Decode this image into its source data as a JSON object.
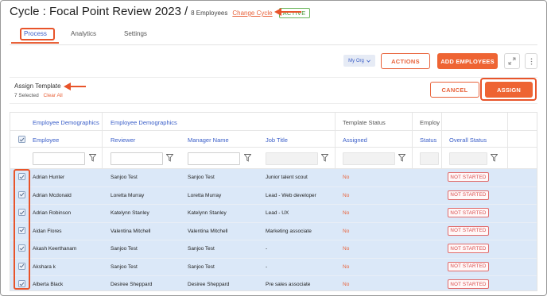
{
  "header": {
    "title": "Cycle : Focal Point Review 2023",
    "separator": "/",
    "employee_count": "8 Employees",
    "change_cycle": "Change Cycle",
    "status": "ACTIVE"
  },
  "tabs": [
    {
      "label": "Process"
    },
    {
      "label": "Analytics"
    },
    {
      "label": "Settings"
    }
  ],
  "toolbar": {
    "org_select": "My Org",
    "actions_label": "ACTIONS",
    "add_employees_label": "ADD EMPLOYEES"
  },
  "template_bar": {
    "title": "Assign Template",
    "selected": "7 Selected",
    "clear_all": "Clear All",
    "cancel_label": "CANCEL",
    "assign_label": "ASSIGN"
  },
  "table": {
    "group_headers": [
      "Employee Demographics",
      "Employee Demographics",
      "Template Status",
      "Employ"
    ],
    "columns": [
      "Employee",
      "Reviewer",
      "Manager Name",
      "Job Title",
      "Assigned",
      "Status",
      "Overall Status"
    ],
    "rows": [
      {
        "employee": "Adrian Hunter",
        "reviewer": "Sanjoo Test",
        "manager": "Sanjoo Test",
        "job": "Junior talent scout",
        "assigned": "No",
        "status": "",
        "overall": "NOT STARTED"
      },
      {
        "employee": "Adrian Mcdonald",
        "reviewer": "Loretta Murray",
        "manager": "Loretta Murray",
        "job": "Lead - Web developer",
        "assigned": "No",
        "status": "",
        "overall": "NOT STARTED"
      },
      {
        "employee": "Adrian Robinson",
        "reviewer": "Katelynn Stanley",
        "manager": "Katelynn Stanley",
        "job": "Lead - UX",
        "assigned": "No",
        "status": "",
        "overall": "NOT STARTED"
      },
      {
        "employee": "Aidan Flores",
        "reviewer": "Valentina Mitchell",
        "manager": "Valentina Mitchell",
        "job": "Marketing associate",
        "assigned": "No",
        "status": "",
        "overall": "NOT STARTED"
      },
      {
        "employee": "Akash Keerthanam",
        "reviewer": "Sanjoo Test",
        "manager": "Sanjoo Test",
        "job": "-",
        "assigned": "No",
        "status": "",
        "overall": "NOT STARTED"
      },
      {
        "employee": "Akshara k",
        "reviewer": "Sanjoo Test",
        "manager": "Sanjoo Test",
        "job": "-",
        "assigned": "No",
        "status": "",
        "overall": "NOT STARTED"
      },
      {
        "employee": "Alberta Black",
        "reviewer": "Desiree Sheppard",
        "manager": "Desiree Sheppard",
        "job": "Pre sales associate",
        "assigned": "No",
        "status": "",
        "overall": "NOT STARTED"
      }
    ]
  },
  "colors": {
    "accent": "#ee6433",
    "link_blue": "#3a5ec8",
    "row_selected": "#dbe8f8",
    "status_red": "#d84a4a",
    "active_green": "#4a9a3a"
  },
  "icons": [
    "chevron-down-icon",
    "expand-icon",
    "more-vertical-icon",
    "filter-icon",
    "checkbox-icon",
    "arrow-icon"
  ]
}
